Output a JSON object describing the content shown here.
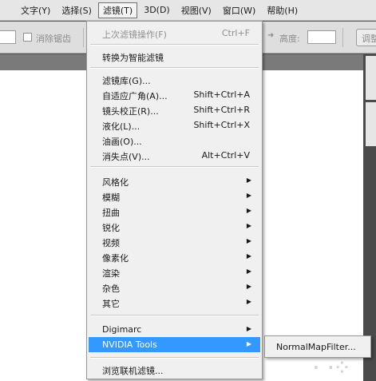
{
  "menubar": {
    "items": [
      "文字(Y)",
      "选择(S)",
      "滤镜(T)",
      "3D(D)",
      "视图(V)",
      "窗口(W)",
      "帮助(H)"
    ],
    "active_index": 2
  },
  "options": {
    "antialias_label": "消除锯齿",
    "height_label": "高度:",
    "adjust_label": "调整"
  },
  "filter_menu": {
    "last_filter": "上次滤镜操作(F)",
    "last_filter_shortcut": "Ctrl+F",
    "convert_smart": "转换为智能滤镜",
    "gallery": "滤镜库(G)...",
    "adaptive_wide": "自适应广角(A)...",
    "adaptive_wide_shortcut": "Shift+Ctrl+A",
    "lens_correction": "镜头校正(R)...",
    "lens_correction_shortcut": "Shift+Ctrl+R",
    "liquify": "液化(L)...",
    "liquify_shortcut": "Shift+Ctrl+X",
    "oil_paint": "油画(O)...",
    "vanishing_point": "消失点(V)...",
    "vanishing_point_shortcut": "Alt+Ctrl+V",
    "stylize": "风格化",
    "blur": "模糊",
    "distort": "扭曲",
    "sharpen": "锐化",
    "video": "视频",
    "pixelate": "像素化",
    "render": "渲染",
    "noise": "杂色",
    "other": "其它",
    "digimarc": "Digimarc",
    "nvidia": "NVIDIA Tools",
    "browse_online": "浏览联机滤镜..."
  },
  "submenu": {
    "item": "NormalMapFilter..."
  },
  "colors": {
    "highlight": "#3399ff",
    "menu_bg": "#f0f0f0",
    "workspace_dark": "#535353"
  },
  "icons": {
    "submenu_arrow": "▶"
  }
}
